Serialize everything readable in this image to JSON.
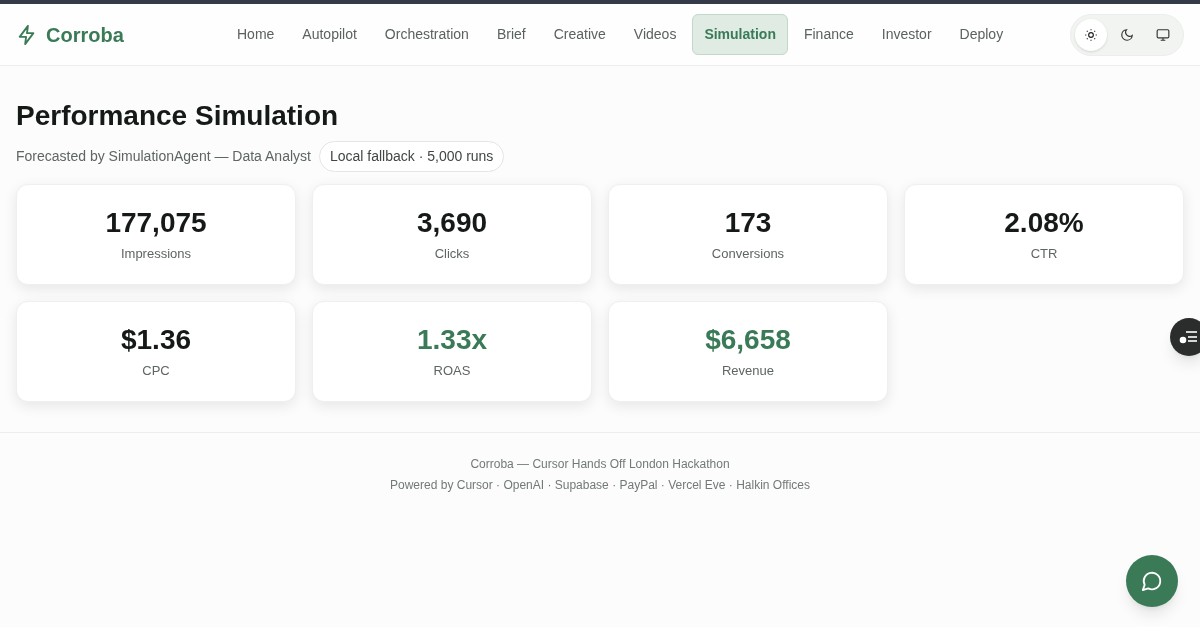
{
  "brand": {
    "name": "Corroba"
  },
  "nav": [
    {
      "label": "Home",
      "selected": false
    },
    {
      "label": "Autopilot",
      "selected": false
    },
    {
      "label": "Orchestration",
      "selected": false
    },
    {
      "label": "Brief",
      "selected": false
    },
    {
      "label": "Creative",
      "selected": false
    },
    {
      "label": "Videos",
      "selected": false
    },
    {
      "label": "Simulation",
      "selected": true
    },
    {
      "label": "Finance",
      "selected": false
    },
    {
      "label": "Investor",
      "selected": false
    },
    {
      "label": "Deploy",
      "selected": false
    }
  ],
  "theme_toggle": [
    {
      "kind": "light",
      "selected": true
    },
    {
      "kind": "dark",
      "selected": false
    },
    {
      "kind": "system",
      "selected": false
    }
  ],
  "page": {
    "title": "Performance Simulation",
    "subtitle": "Forecasted by SimulationAgent — Data Analyst",
    "badge": "Local fallback · 5,000 runs"
  },
  "metrics": [
    {
      "value": "177,075",
      "label": "Impressions",
      "highlight": false
    },
    {
      "value": "3,690",
      "label": "Clicks",
      "highlight": false
    },
    {
      "value": "173",
      "label": "Conversions",
      "highlight": false
    },
    {
      "value": "2.08%",
      "label": "CTR",
      "highlight": false
    },
    {
      "value": "$1.36",
      "label": "CPC",
      "highlight": false
    },
    {
      "value": "1.33x",
      "label": "ROAS",
      "highlight": true
    },
    {
      "value": "$6,658",
      "label": "Revenue",
      "highlight": true
    }
  ],
  "footer": {
    "line_1": "Corroba — Cursor Hands Off London Hackathon",
    "line_2": "Powered by Cursor · OpenAI · Supabase · PayPal · Vercel Eve · Halkin Offices"
  }
}
